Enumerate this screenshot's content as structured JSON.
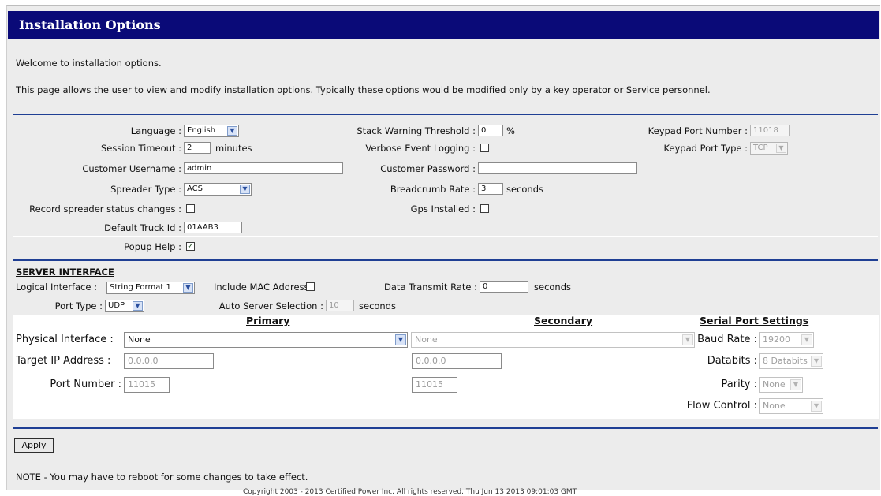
{
  "page": {
    "title": "Installation Options",
    "welcome": "Welcome to installation options.",
    "description": "This page allows the user to view and modify installation options. Typically these options would be modified only by a key operator or Service personnel."
  },
  "general": {
    "language_label": "Language :",
    "language_value": "English",
    "session_timeout_label": "Session Timeout :",
    "session_timeout_value": "2",
    "session_timeout_unit": "minutes",
    "customer_username_label": "Customer Username :",
    "customer_username_value": "admin",
    "spreader_type_label": "Spreader Type :",
    "spreader_type_value": "ACS",
    "record_spreader_label": "Record spreader status changes :",
    "default_truck_id_label": "Default Truck Id :",
    "default_truck_id_value": "01AAB3",
    "popup_help_label": "Popup Help :",
    "stack_warning_label": "Stack Warning Threshold :",
    "stack_warning_value": "0",
    "stack_warning_unit": "%",
    "verbose_logging_label": "Verbose Event Logging :",
    "customer_password_label": "Customer Password :",
    "customer_password_value": "",
    "breadcrumb_rate_label": "Breadcrumb Rate :",
    "breadcrumb_rate_value": "3",
    "breadcrumb_rate_unit": "seconds",
    "gps_installed_label": "Gps Installed :",
    "keypad_port_number_label": "Keypad Port Number :",
    "keypad_port_number_value": "11018",
    "keypad_port_type_label": "Keypad Port Type :",
    "keypad_port_type_value": "TCP"
  },
  "server": {
    "section_title": "SERVER INTERFACE",
    "logical_interface_label": "Logical Interface :",
    "logical_interface_value": "String Format 1",
    "include_mac_label": "Include MAC Address :",
    "data_transmit_label": "Data Transmit Rate :",
    "data_transmit_value": "0",
    "data_transmit_unit": "seconds",
    "port_type_label": "Port Type :",
    "port_type_value": "UDP",
    "auto_server_label": "Auto Server Selection :",
    "auto_server_value": "10",
    "auto_server_unit": "seconds"
  },
  "interfaces": {
    "primary_header": "Primary",
    "secondary_header": "Secondary",
    "serial_header": "Serial Port Settings",
    "physical_interface_label": "Physical Interface :",
    "primary_physical_value": "None",
    "secondary_physical_value": "None",
    "target_ip_label": "Target IP Address :",
    "primary_ip_value": "0.0.0.0",
    "secondary_ip_value": "0.0.0.0",
    "port_number_label": "Port Number :",
    "primary_port_value": "11015",
    "secondary_port_value": "11015",
    "baud_rate_label": "Baud Rate :",
    "baud_rate_value": "19200",
    "databits_label": "Databits :",
    "databits_value": "8 Databits",
    "parity_label": "Parity :",
    "parity_value": "None",
    "flow_control_label": "Flow Control :",
    "flow_control_value": "None"
  },
  "footer": {
    "apply_label": "Apply",
    "note": "NOTE - You may have to reboot for some changes to take effect.",
    "copyright": "Copyright 2003 - 2013 Certified Power Inc. All rights reserved. Thu Jun 13 2013 09:01:03 GMT"
  },
  "icons": {
    "dropdown_arrow": "chevron-down-icon",
    "check": "checkmark-icon"
  },
  "colors": {
    "title_bar": "#0a0a78",
    "divider": "#1f3f94",
    "panel": "#ececec"
  }
}
